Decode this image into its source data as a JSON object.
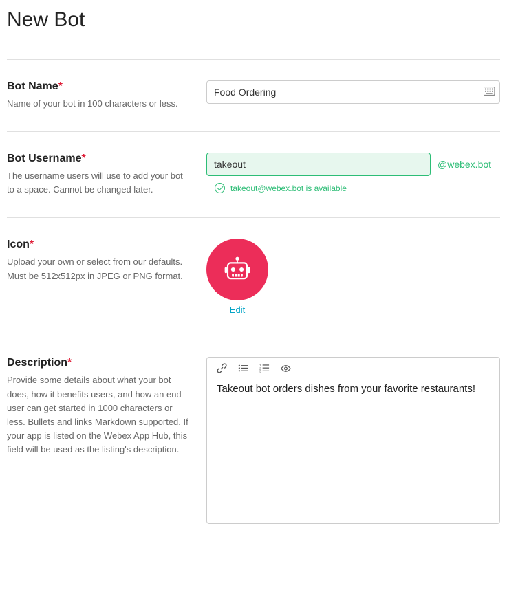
{
  "page": {
    "title": "New Bot"
  },
  "botName": {
    "label": "Bot Name",
    "help": "Name of your bot in 100 characters or less.",
    "value": "Food Ordering"
  },
  "botUsername": {
    "label": "Bot Username",
    "help": "The username users will use to add your bot to a space. Cannot be changed later.",
    "value": "takeout",
    "suffix": "@webex.bot",
    "availability": "takeout@webex.bot is available"
  },
  "icon": {
    "label": "Icon",
    "help": "Upload your own or select from our defaults. Must be 512x512px in JPEG or PNG format.",
    "editLabel": "Edit"
  },
  "description": {
    "label": "Description",
    "help": "Provide some details about what your bot does, how it benefits users, and how an end user can get started in 1000 characters or less. Bullets and links Markdown supported. If your app is listed on the Webex App Hub, this field will be used as the listing's description.",
    "value": "Takeout bot orders dishes from your favorite restaurants!"
  }
}
